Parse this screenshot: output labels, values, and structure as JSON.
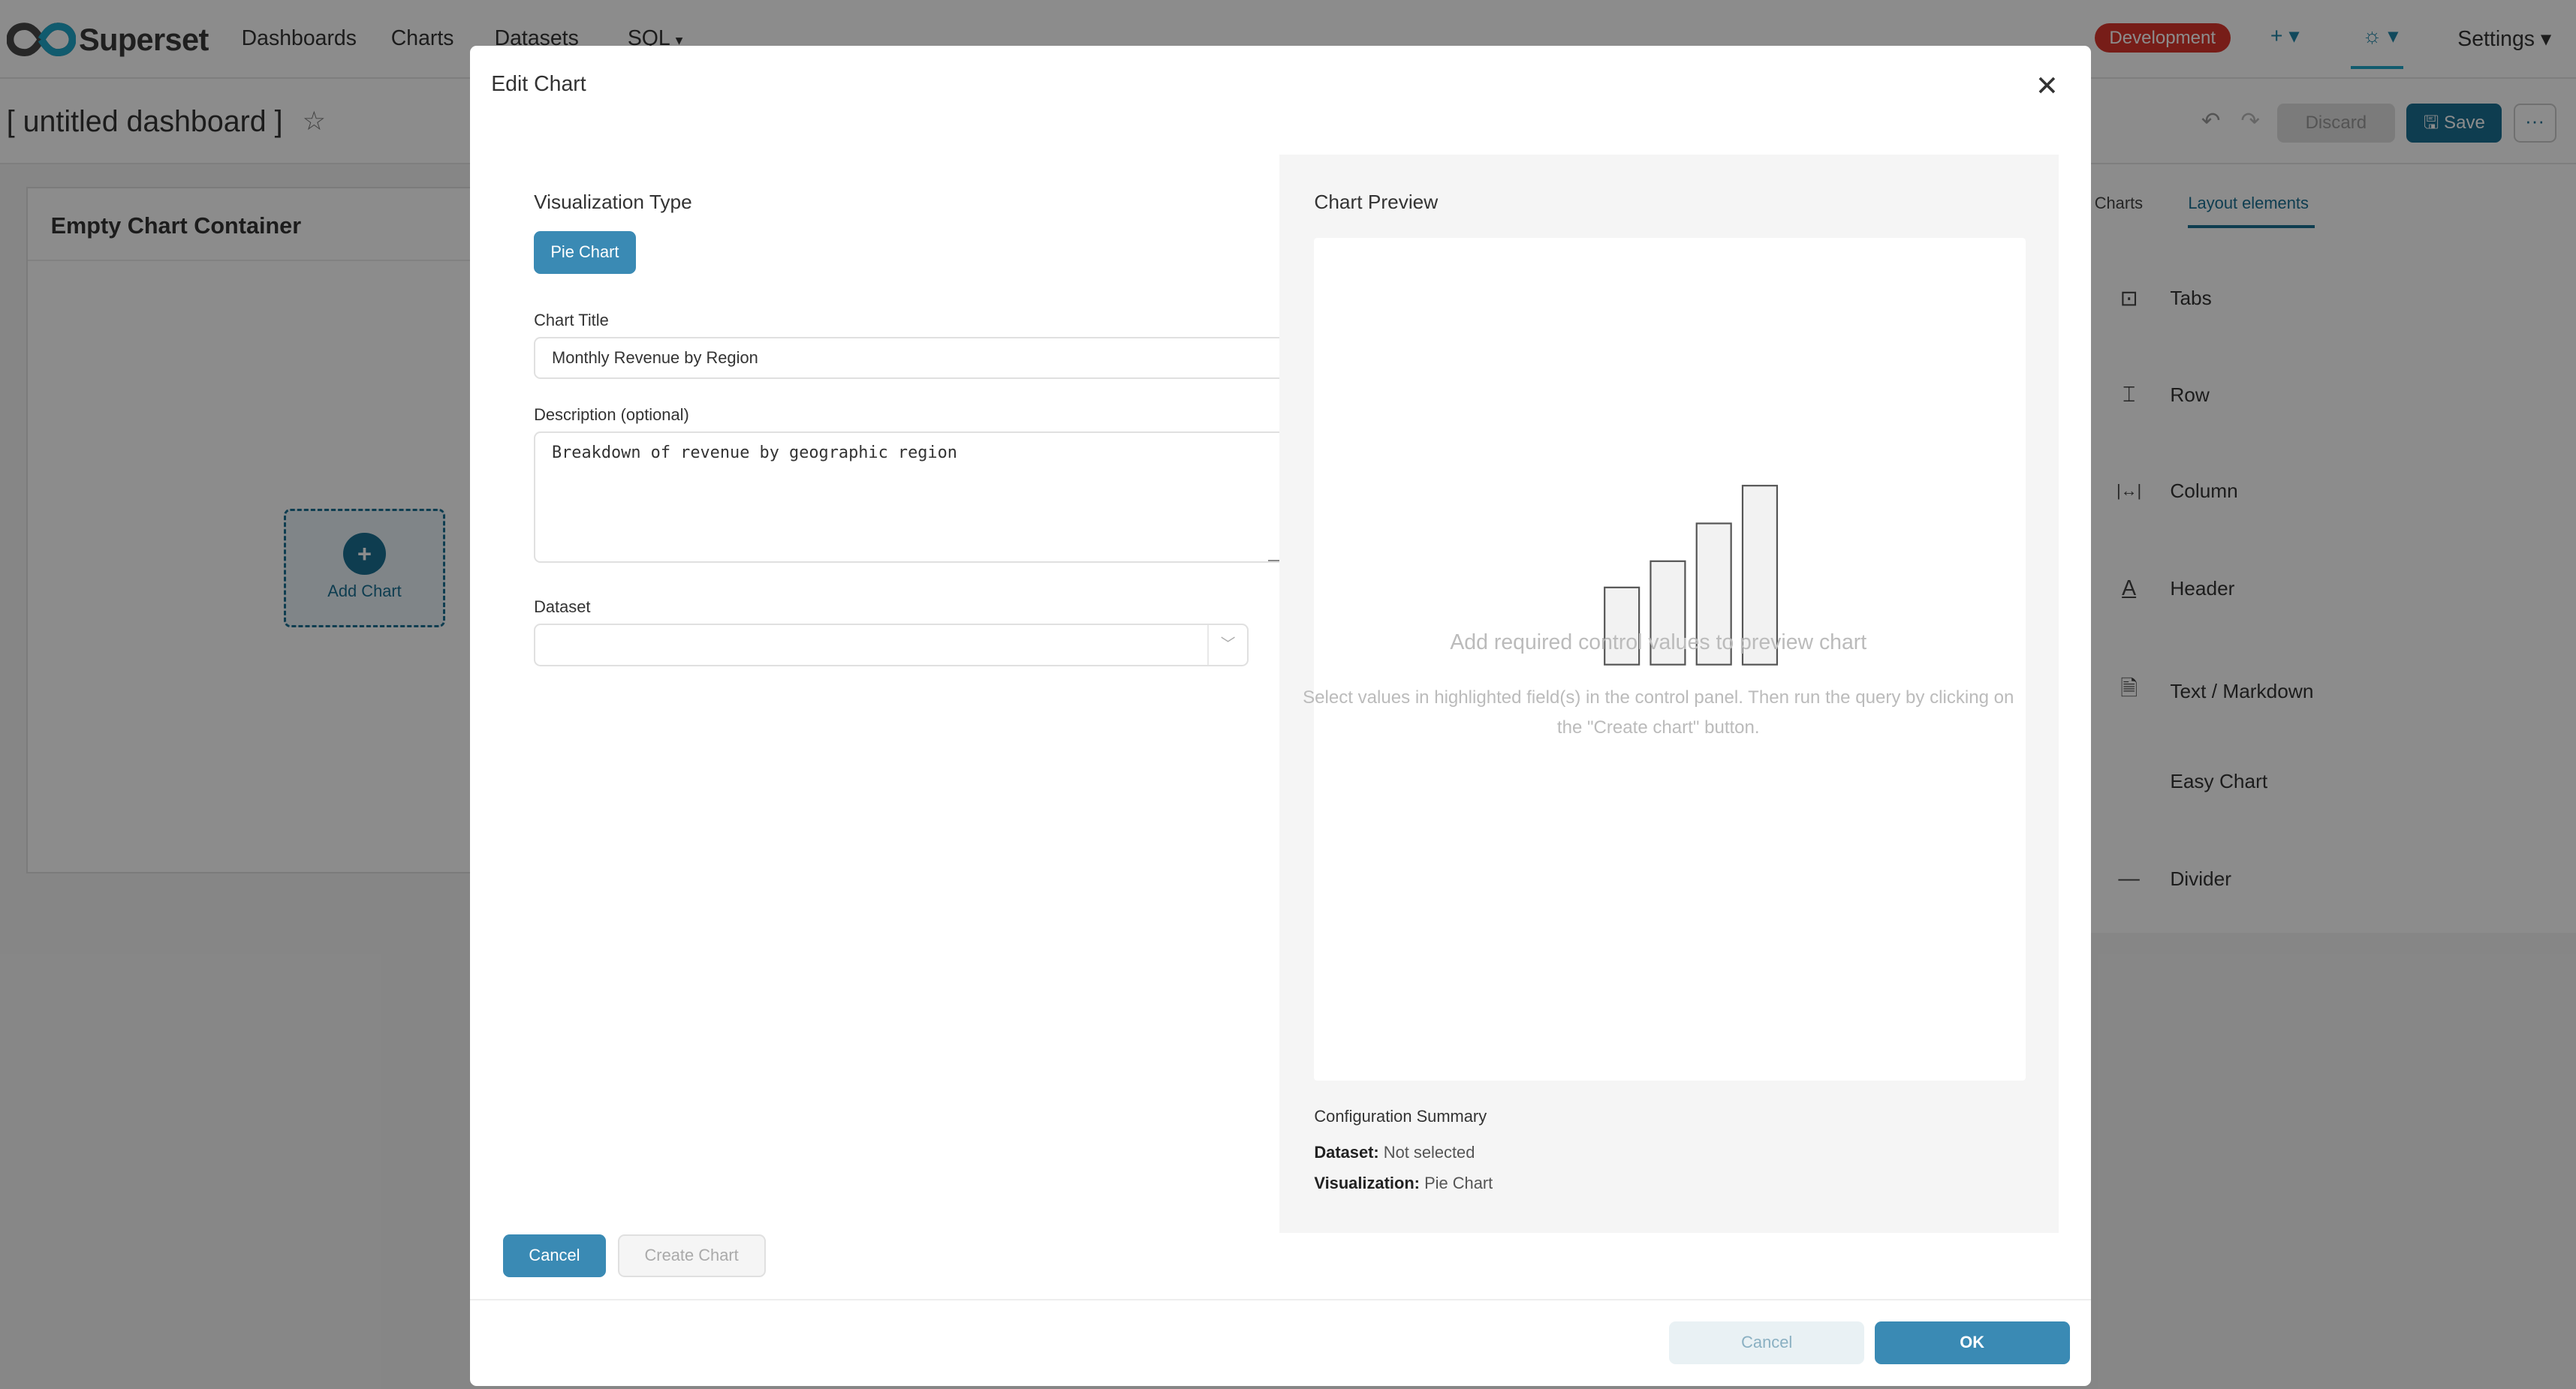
{
  "nav": {
    "brand": "Superset",
    "items": [
      "Dashboards",
      "Charts",
      "Datasets",
      "SQL"
    ],
    "sql_caret": "▾",
    "env_badge": "Development",
    "plus_label": "+ ▾",
    "theme_label": "☼ ▾",
    "settings": "Settings ▾"
  },
  "dashboard": {
    "title": "[ untitled dashboard ]",
    "discard": "Discard",
    "save": "Save",
    "more": "···",
    "chart_container_title": "Empty Chart Container",
    "add_chart": "Add Chart"
  },
  "side_panel": {
    "tabs": [
      "Charts",
      "Layout elements"
    ],
    "items": [
      {
        "icon": "tabs-icon",
        "glyph": "⊡",
        "label": "Tabs"
      },
      {
        "icon": "row-icon",
        "glyph": "⌶",
        "label": "Row"
      },
      {
        "icon": "column-icon",
        "glyph": "|↔|",
        "label": "Column"
      },
      {
        "icon": "header-icon",
        "glyph": "A",
        "label": "Header"
      },
      {
        "icon": "markdown-icon",
        "glyph": "🗎",
        "label": "Text / Markdown"
      },
      {
        "icon": "",
        "glyph": "",
        "label": "Easy Chart"
      },
      {
        "icon": "divider-icon",
        "glyph": "—",
        "label": "Divider"
      }
    ]
  },
  "modal": {
    "title": "Edit Chart",
    "close": "✕",
    "viz_type_label": "Visualization Type",
    "viz_type_value": "Pie Chart",
    "chart_title_label": "Chart Title",
    "chart_title_value": "Monthly Revenue by Region",
    "description_label": "Description (optional)",
    "description_value": "Breakdown of revenue by geographic region",
    "dataset_label": "Dataset",
    "preview_title": "Chart Preview",
    "empty_title": "Add required control values to preview chart",
    "empty_desc": "Select values in highlighted field(s) in the control panel. Then run the query by clicking on the \"Create chart\" button.",
    "config_title": "Configuration Summary",
    "config_dataset_key": "Dataset:",
    "config_dataset_value": "Not selected",
    "config_viz_key": "Visualization:",
    "config_viz_value": "Pie Chart",
    "cancel": "Cancel",
    "create_chart": "Create Chart",
    "footer_cancel": "Cancel",
    "ok": "OK"
  },
  "colors": {
    "primary": "#1a6f93",
    "primary_light": "#3a8ab4",
    "badge": "#d9362c"
  }
}
